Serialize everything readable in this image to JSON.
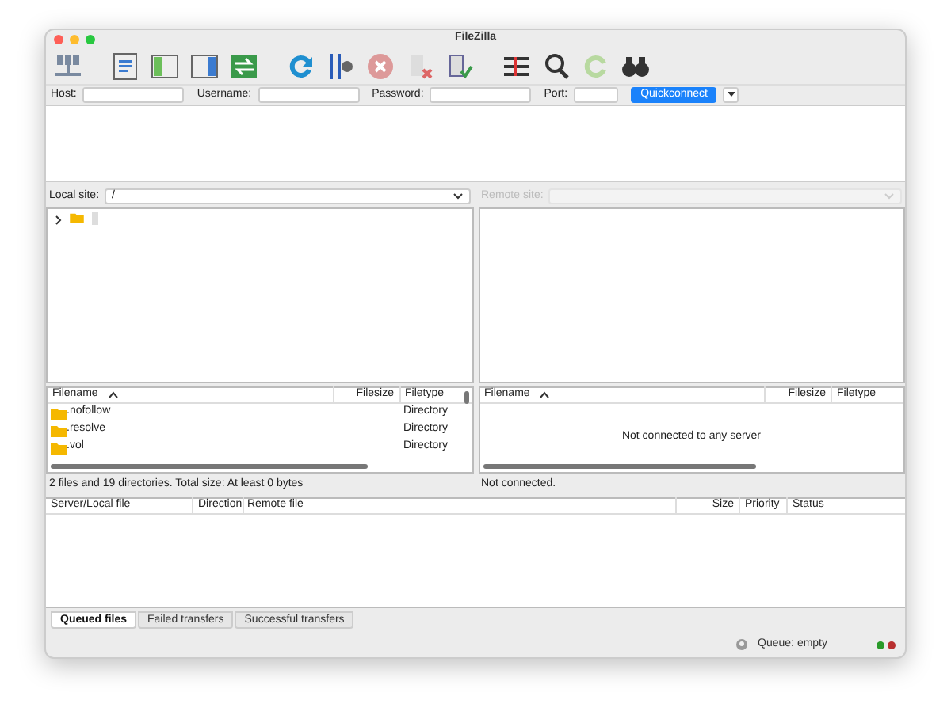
{
  "window": {
    "title": "FileZilla"
  },
  "quickconnect": {
    "fields": [
      {
        "label": "Host:"
      },
      {
        "label": "Username:"
      },
      {
        "label": "Password:"
      },
      {
        "label": "Port:"
      }
    ],
    "button": "Quickconnect"
  },
  "local": {
    "site_label": "Local site:",
    "path": "/",
    "columns": [
      "Filename",
      "Filesize",
      "Filetype"
    ],
    "rows": [
      {
        "name": ".nofollow",
        "type": "Directory"
      },
      {
        "name": ".resolve",
        "type": "Directory"
      },
      {
        "name": ".vol",
        "type": "Directory"
      }
    ],
    "status": "2 files and 19 directories. Total size: At least 0 bytes"
  },
  "remote": {
    "site_label": "Remote site:",
    "disabled": true,
    "columns": [
      "Filename",
      "Filesize",
      "Filetype"
    ],
    "message": "Not connected to any server",
    "status": "Not connected."
  },
  "queue": {
    "columns": [
      "Server/Local file",
      "Direction",
      "Remote file",
      "Size",
      "Priority",
      "Status"
    ]
  },
  "tabs": [
    {
      "label": "Queued files",
      "selected": true
    },
    {
      "label": "Failed transfers",
      "selected": false
    },
    {
      "label": "Successful transfers",
      "selected": false
    }
  ],
  "status_bar": {
    "queue": "Queue: empty"
  }
}
